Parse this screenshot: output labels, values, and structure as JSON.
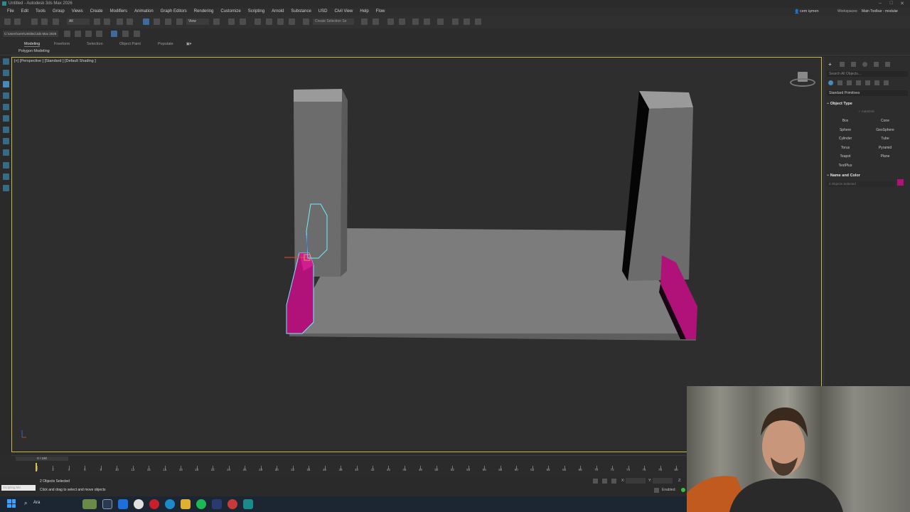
{
  "window": {
    "title": "Untitled - Autodesk 3ds Max 2026"
  },
  "menu": [
    "File",
    "Edit",
    "Tools",
    "Group",
    "Views",
    "Create",
    "Modifiers",
    "Animation",
    "Graph Editors",
    "Rendering",
    "Customize",
    "Scripting",
    "Arnold",
    "Substance",
    "USD",
    "Civil View",
    "Help",
    "Flow"
  ],
  "user": {
    "name": "cem işmen",
    "workspaces_label": "Workspaces:",
    "workspace_value": "Main Toolbar - modular"
  },
  "toolbar": {
    "filter_value": "All",
    "view_value": "View",
    "selection_set_placeholder": "Create Selection Se"
  },
  "path_field": "C:\\Users\\cem\\Untitled.3ds Max 2026",
  "ribbon": {
    "tabs": [
      "Modeling",
      "Freeform",
      "Selection",
      "Object Paint",
      "Populate"
    ],
    "active_tab": "Modeling",
    "subtitle": "Polygon Modeling"
  },
  "viewport": {
    "label": "[+] [Perspective ] [Standard ] [Default Shading ]"
  },
  "command_panel": {
    "search_placeholder": "Search All Objects...",
    "category_value": "Standard Primitives",
    "object_type_header": "Object Type",
    "autogrid_label": "AutoGrid",
    "buttons": [
      "Box",
      "Cone",
      "Sphere",
      "GeoSphere",
      "Cylinder",
      "Tube",
      "Torus",
      "Pyramid",
      "Teapot",
      "Plane",
      "TextPlus"
    ],
    "name_color_header": "Name and Color",
    "name_value": "2 Objects Selected",
    "object_color": "#b0127a"
  },
  "timeline": {
    "frame_label": "0 / 100",
    "ticks": [
      "0",
      "2",
      "4",
      "6",
      "8",
      "10",
      "12",
      "14",
      "16",
      "18",
      "20",
      "22",
      "24",
      "26",
      "28",
      "30",
      "32",
      "34",
      "36",
      "38",
      "40",
      "42",
      "44",
      "46",
      "48",
      "50",
      "52",
      "54",
      "56",
      "58",
      "60",
      "62",
      "64",
      "66",
      "68",
      "70",
      "72",
      "74",
      "76",
      "78",
      "80"
    ]
  },
  "status": {
    "selection": "2 Objects Selected",
    "prompt": "Click and drag to select and move objects",
    "script_label": "Scripting Mo",
    "enabled_label": "Enabled:"
  },
  "coords": {
    "x_label": "X:",
    "y_label": "Y:",
    "z_label": "Z:"
  },
  "taskbar": {
    "search_label": "Ara"
  }
}
